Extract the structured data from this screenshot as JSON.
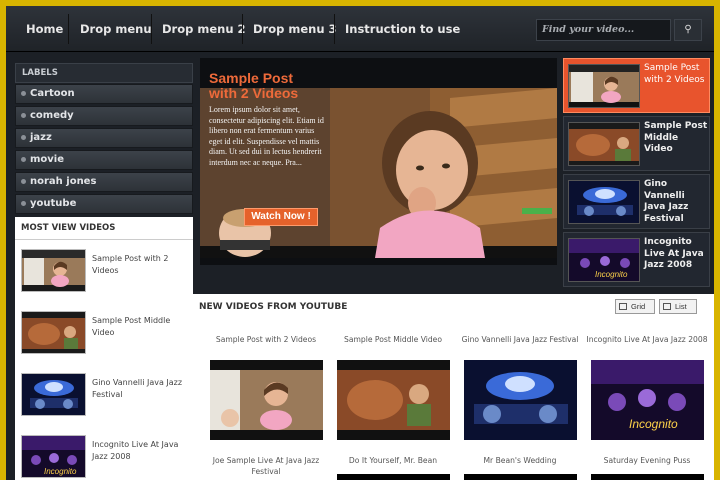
{
  "nav": {
    "items": [
      "Home",
      "Drop menu",
      "Drop menu 2",
      "Drop menu 3",
      "Instruction to use"
    ],
    "search_placeholder": "Find your video...",
    "search_icon": "magnifier-icon"
  },
  "sidebar": {
    "labels_title": "LABELS",
    "labels": [
      "Cartoon",
      "comedy",
      "jazz",
      "movie",
      "norah jones",
      "youtube"
    ],
    "most_viewed_title": "MOST VIEW VIDEOS",
    "most_viewed": [
      "Sample Post with 2 Videos",
      "Sample Post Middle Video",
      "Gino Vannelli Java Jazz Festival",
      "Incognito Live At Java Jazz 2008"
    ]
  },
  "feature": {
    "title": "Sample Post with 2 Videos",
    "description": "Lorem ipsum dolor sit amet, consectetur adipiscing elit. Etiam id libero non erat fermentum varius eget id elit. Suspendisse vel mattis diam. Ut sed dui in lectus hendrerit interdum nec ac neque. Pra...",
    "watch_label": "Watch Now !"
  },
  "right_list": [
    "Sample Post with 2 Videos",
    "Sample Post Middle Video",
    "Gino Vannelli Java Jazz Festival",
    "Incognito Live At Java Jazz 2008"
  ],
  "new_videos": {
    "title": "NEW VIDEOS FROM YOUTUBE",
    "grid_label": "Grid",
    "list_label": "List",
    "row1": [
      "Sample Post with 2 Videos",
      "Sample Post Middle Video",
      "Gino Vannelli Java Jazz Festival",
      "Incognito Live At Java Jazz 2008"
    ],
    "row2": [
      "Joe Sample Live At Java Jazz Festival",
      "Do It Yourself, Mr. Bean",
      "Mr Bean's Wedding",
      "Saturday Evening Puss"
    ]
  },
  "colors": {
    "accent": "#e8542d",
    "nav_bg": "#272c32",
    "frame": "#d8b400"
  }
}
